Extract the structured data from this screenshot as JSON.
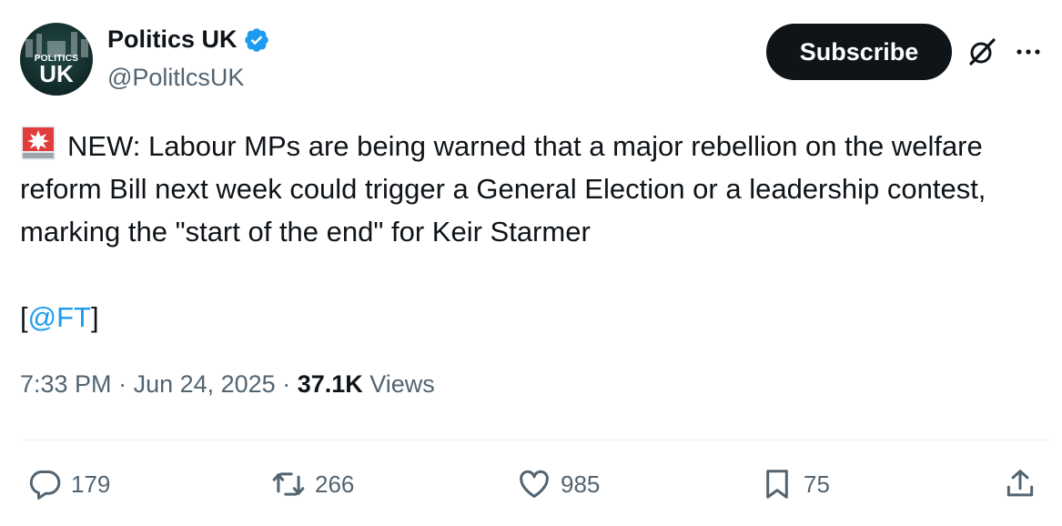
{
  "author": {
    "display_name": "Politics UK",
    "handle": "@PolitlcsUK",
    "avatar_text_small": "POLITICS",
    "avatar_text_big": "UK",
    "verified_icon": "verified-badge-icon"
  },
  "header": {
    "subscribe_label": "Subscribe"
  },
  "tweet": {
    "text": "NEW: Labour MPs are being warned that a major rebellion on the welfare reform Bill next week could trigger a General Election or a leadership contest, marking the \"start of the end\" for Keir Starmer",
    "bracket_open": "[",
    "mention": "@FT",
    "bracket_close": "]"
  },
  "meta": {
    "time": "7:33 PM",
    "sep1": " · ",
    "date": "Jun 24, 2025",
    "sep2": " · ",
    "views_count": "37.1K",
    "views_label": " Views"
  },
  "actions": {
    "replies": "179",
    "reposts": "266",
    "likes": "985",
    "bookmarks": "75"
  },
  "colors": {
    "accent": "#1d9bf0",
    "text": "#0f1419",
    "muted": "#536471",
    "button_bg": "#0f1419"
  }
}
